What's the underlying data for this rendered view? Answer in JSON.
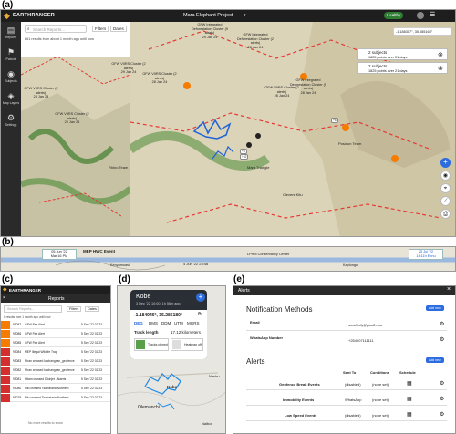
{
  "labels": {
    "a": "(a)",
    "b": "(b)",
    "c": "(c)",
    "d": "(d)",
    "e": "(e)"
  },
  "panel_a": {
    "brand": "EARTHRANGER",
    "project": "Mara Elephant Project",
    "status": "Healthy",
    "user": "",
    "coords": "-1.188307°, 35.085165°",
    "sidebar": [
      "Reports",
      "Patrols",
      "Subjects",
      "Map Layers",
      "Settings"
    ],
    "search_placeholder": "Search Reports...",
    "filters": "Filters",
    "dates": "Dates",
    "results": "861 results from about 1 month ago until now",
    "subject_cards": [
      {
        "title": "2 subjects",
        "sub": "1825 points over 21 days"
      },
      {
        "title": "2 subjects",
        "sub": "1825 points over 21 days"
      }
    ],
    "map_labels": [
      {
        "text": "GFW Integrated Deforestation Cluster (9 alerts)",
        "date": "29 Jan 24"
      },
      {
        "text": "GFW VIIRS Cluster (2 alerts)",
        "date": "29 Jan 24"
      },
      {
        "text": "GFW Integrated Deforestation Cluster (2 alerts)",
        "date": "28 Jan 24"
      },
      {
        "text": "GFW Integrated Deforestation Cluster (5 alerts)",
        "date": "28 Jan 24"
      },
      {
        "text": "GFW VIIRS Cluster (2 alerts)",
        "date": "28 Jan 24"
      },
      {
        "text": "GFW VIIRS Cluster (2 alerts)",
        "date": "29 Jan 24"
      },
      {
        "text": "GFW VIIRS Cluster (2 alerts)",
        "date": "28 Jan 24"
      },
      {
        "text": "GFW VIIRS Cluster (2 alerts)",
        "date": "28 Jan 24"
      },
      {
        "text": "Mara Triangle",
        "date": ""
      },
      {
        "text": "Clevers Kitu",
        "date": ""
      },
      {
        "text": "Rhino Team",
        "date": ""
      },
      {
        "text": "Posidon Team",
        "date": ""
      }
    ],
    "counters": [
      "+4",
      "+52",
      "+6"
    ]
  },
  "panel_b": {
    "left_date": "05 Jun '22",
    "left_sub": "Mar 16 PM",
    "event": "MEP HWC Event",
    "middle": "4 Jun '22 23:48",
    "right_date": "25 Jul '22",
    "right_sub": "14:11h Ennu",
    "place1": "Kenyamoasi",
    "place2": "LPHM Conservancy Center",
    "place3": "Kaplongo"
  },
  "panel_c": {
    "brand": "EARTHRANGER",
    "title": "Reports",
    "search_placeholder": "Search Reports...",
    "filters": "Filters",
    "dates": "Dates",
    "results": "0 results from 1 month ago until now",
    "rows": [
      {
        "id": "95087",
        "name": "GFW Fire Alert",
        "time": "5 Sep '22 02:23"
      },
      {
        "id": "95086",
        "name": "GFW Fire Alert",
        "time": "5 Sep '22 02:23"
      },
      {
        "id": "95085",
        "name": "GFW Fire Alert",
        "time": "5 Sep '22 02:23"
      },
      {
        "id": "95084",
        "name": "MEP Illegal Wildlife Trap",
        "time": "5 Sep '22 02:23"
      },
      {
        "id": "95083",
        "name": "Rhan crossed kachangaan_geofence",
        "time": "5 Sep '22 02:23"
      },
      {
        "id": "95082",
        "name": "Rhan crossed kachangaan_geofence",
        "time": "5 Sep '22 02:23"
      },
      {
        "id": "95081",
        "name": "Hitam crossed Dikinjet - Naeris",
        "time": "5 Sep '22 02:23"
      },
      {
        "id": "95080",
        "name": "Fitu crossed Tsavoriana Northern",
        "time": "5 Sep '22 02:23"
      },
      {
        "id": "95079",
        "name": "Fitu crossed Tsavoriana Northern",
        "time": "5 Sep '22 02:23"
      }
    ],
    "footer": "No more results to show"
  },
  "panel_d": {
    "name": "Kobe",
    "time": "3 Dec '22 10:00, 1h 56m ago",
    "coords": "-1.184946°, 35.285180°",
    "formats": [
      "DEG",
      "DMS",
      "DDM",
      "UTM",
      "MGRS"
    ],
    "track_label": "Track length",
    "track_value": "17.12 kilometers",
    "tracks_pinned": "Tracks pinned",
    "heatmap": "Heatmap off",
    "place1": "Olemanchi",
    "place2": "Nashu",
    "place3": "Naibor",
    "marker": "Kobe"
  },
  "panel_e": {
    "title": "Alerts",
    "notif_title": "Notification Methods",
    "add_new": "Add new",
    "methods": [
      {
        "label": "Email",
        "value": "somebody@gmail.com"
      },
      {
        "label": "WhatsApp Number",
        "value": "+254007111111"
      }
    ],
    "alerts_title": "Alerts",
    "headers": [
      "Sent To",
      "Conditions",
      "Schedule"
    ],
    "alerts": [
      {
        "name": "Geofence Break Events",
        "sent": "(disabled)",
        "cond": "(none set)"
      },
      {
        "name": "Immobility Events",
        "sent": "WhatsApp",
        "cond": "(none set)"
      },
      {
        "name": "Low Speed Events",
        "sent": "(disabled)",
        "cond": "(none set)"
      }
    ]
  }
}
